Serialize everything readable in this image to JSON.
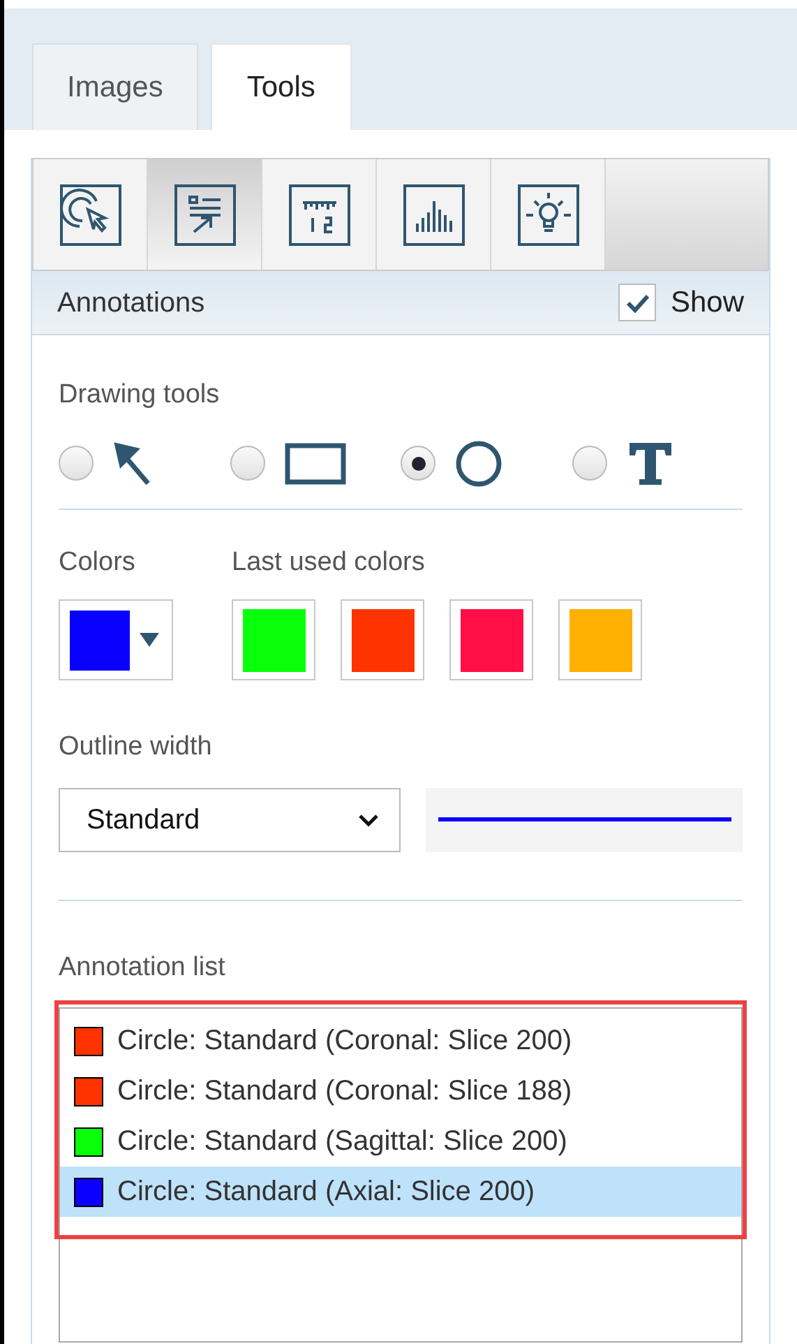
{
  "tabs": [
    {
      "label": "Images",
      "selected": false
    },
    {
      "label": "Tools",
      "selected": true
    }
  ],
  "toolbar": [
    {
      "kind": "select-tool",
      "selected": false
    },
    {
      "kind": "annotation",
      "selected": true
    },
    {
      "kind": "measure",
      "selected": false
    },
    {
      "kind": "histogram",
      "selected": false
    },
    {
      "kind": "light",
      "selected": false
    }
  ],
  "section": {
    "title": "Annotations",
    "show": {
      "label": "Show",
      "checked": true
    }
  },
  "drawing_tools": {
    "label": "Drawing tools",
    "options": [
      {
        "kind": "arrow",
        "selected": false
      },
      {
        "kind": "rectangle",
        "selected": false
      },
      {
        "kind": "circle",
        "selected": true
      },
      {
        "kind": "text",
        "selected": false
      }
    ]
  },
  "colors": {
    "label": "Colors",
    "current": {
      "color": "#0a00ff"
    }
  },
  "last_used_colors": {
    "label": "Last used colors",
    "swatches": [
      {
        "color": "#0aff0a"
      },
      {
        "color": "#ff3300"
      },
      {
        "color": "#ff0f45"
      },
      {
        "color": "#ffb000"
      }
    ]
  },
  "outline_width": {
    "label": "Outline width",
    "value": "Standard"
  },
  "annotation_list": {
    "label": "Annotation list",
    "items": [
      {
        "text": "Circle: Standard (Coronal: Slice 200)",
        "color": "#ff3300",
        "selected": false
      },
      {
        "text": "Circle: Standard (Coronal: Slice 188)",
        "color": "#ff3300",
        "selected": false
      },
      {
        "text": "Circle: Standard (Sagittal: Slice 200)",
        "color": "#0aff0a",
        "selected": false
      },
      {
        "text": "Circle: Standard (Axial: Slice 200)",
        "color": "#0a00ff",
        "selected": true
      }
    ]
  }
}
